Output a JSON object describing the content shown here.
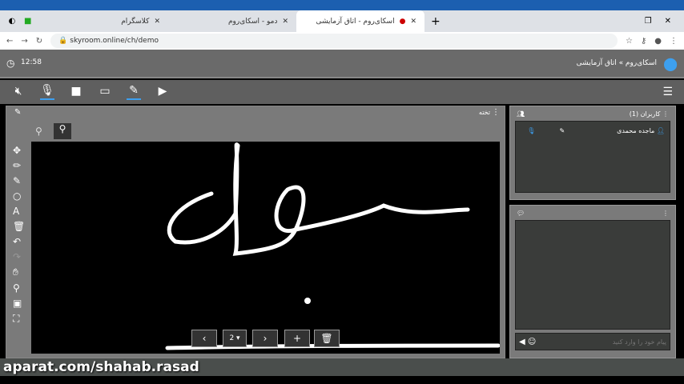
{
  "browser": {
    "tabs": [
      {
        "title": "کلاسگرام"
      },
      {
        "title": "دمو - اسکای‌روم"
      },
      {
        "title": "اسکای‌روم - اتاق آزمایشی"
      }
    ],
    "url": "skyroom.online/ch/demo",
    "new_tab": "+"
  },
  "header": {
    "time": "12:58",
    "breadcrumb": "اسکای‌روم » اتاق آزمایشی"
  },
  "board": {
    "title": "تخته",
    "page": "2"
  },
  "users": {
    "title": "کاربران (1)",
    "items": [
      {
        "name": "ماجده محمدی"
      }
    ]
  },
  "chat": {
    "placeholder": "پیام خود را وارد کنید"
  },
  "watermark": "aparat.com/shahab.rasad",
  "colors": {
    "accent": "#3da0f0",
    "panel": "#7a7a7a"
  }
}
